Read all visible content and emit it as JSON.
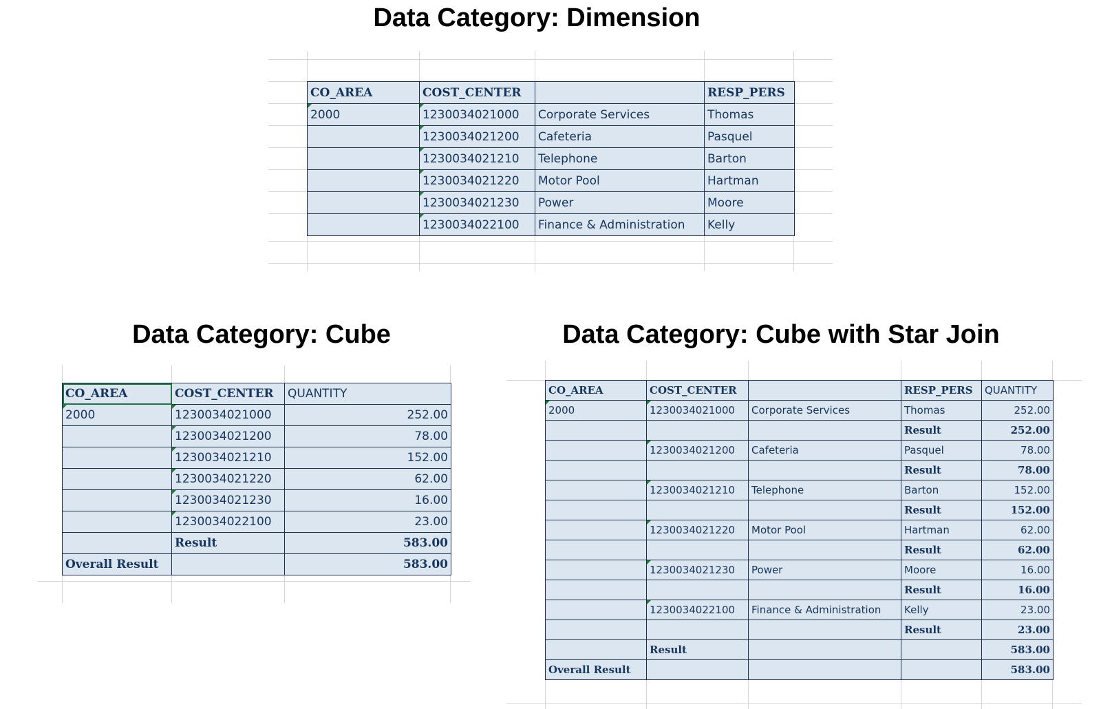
{
  "titles": {
    "dimension": "Data Category: Dimension",
    "cube": "Data Category: Cube",
    "star": "Data Category: Cube with Star Join"
  },
  "dimension": {
    "headers": [
      "CO_AREA",
      "COST_CENTER",
      "",
      "RESP_PERS"
    ],
    "rows": [
      [
        "2000",
        "1230034021000",
        "Corporate Services",
        "Thomas"
      ],
      [
        "",
        "1230034021200",
        "Cafeteria",
        "Pasquel"
      ],
      [
        "",
        "1230034021210",
        "Telephone",
        "Barton"
      ],
      [
        "",
        "1230034021220",
        "Motor Pool",
        "Hartman"
      ],
      [
        "",
        "1230034021230",
        "Power",
        "Moore"
      ],
      [
        "",
        "1230034022100",
        "Finance & Administration",
        "Kelly"
      ]
    ]
  },
  "cube": {
    "headers": [
      "CO_AREA",
      "COST_CENTER",
      "QUANTITY"
    ],
    "rows": [
      [
        "2000",
        "1230034021000",
        "252.00"
      ],
      [
        "",
        "1230034021200",
        "78.00"
      ],
      [
        "",
        "1230034021210",
        "152.00"
      ],
      [
        "",
        "1230034021220",
        "62.00"
      ],
      [
        "",
        "1230034021230",
        "16.00"
      ],
      [
        "",
        "1230034022100",
        "23.00"
      ]
    ],
    "result_label": "Result",
    "result_value": "583.00",
    "overall_label": "Overall Result",
    "overall_value": "583.00"
  },
  "star": {
    "headers": [
      "CO_AREA",
      "COST_CENTER",
      "",
      "RESP_PERS",
      "QUANTITY"
    ],
    "rows": [
      [
        "2000",
        "1230034021000",
        "Corporate Services",
        "Thomas",
        "252.00"
      ],
      [
        "",
        "",
        "",
        "Result",
        "252.00"
      ],
      [
        "",
        "1230034021200",
        "Cafeteria",
        "Pasquel",
        "78.00"
      ],
      [
        "",
        "",
        "",
        "Result",
        "78.00"
      ],
      [
        "",
        "1230034021210",
        "Telephone",
        "Barton",
        "152.00"
      ],
      [
        "",
        "",
        "",
        "Result",
        "152.00"
      ],
      [
        "",
        "1230034021220",
        "Motor Pool",
        "Hartman",
        "62.00"
      ],
      [
        "",
        "",
        "",
        "Result",
        "62.00"
      ],
      [
        "",
        "1230034021230",
        "Power",
        "Moore",
        "16.00"
      ],
      [
        "",
        "",
        "",
        "Result",
        "16.00"
      ],
      [
        "",
        "1230034022100",
        "Finance & Administration",
        "Kelly",
        "23.00"
      ],
      [
        "",
        "",
        "",
        "Result",
        "23.00"
      ],
      [
        "",
        "Result",
        "",
        "",
        "583.00"
      ],
      [
        "Overall Result",
        "",
        "",
        "",
        "583.00"
      ]
    ]
  }
}
